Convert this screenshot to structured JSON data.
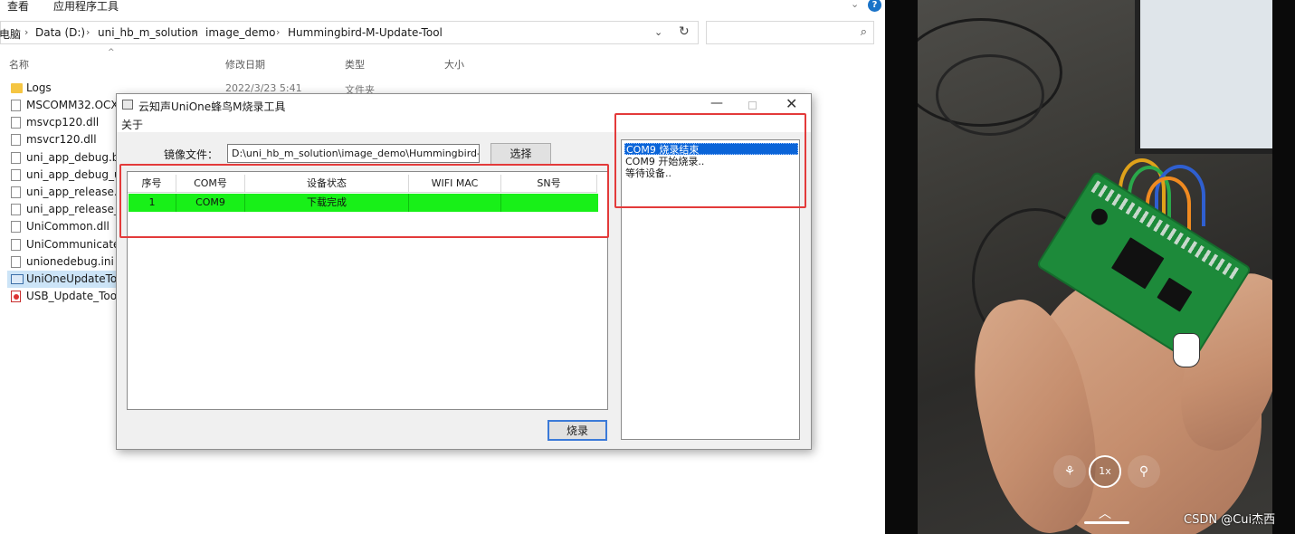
{
  "explorer": {
    "ribbon": {
      "tab_view": "查看",
      "tab_app_tools": "应用程序工具"
    },
    "breadcrumb": {
      "root": "电脑",
      "parts": [
        "Data (D:)",
        "uni_hb_m_solution",
        "image_demo",
        "Hummingbird-M-Update-Tool"
      ]
    },
    "columns": {
      "name": "名称",
      "date": "修改日期",
      "type": "类型",
      "size": "大小"
    },
    "first_row": {
      "date": "2022/3/23 5:41",
      "type": "文件夹"
    },
    "files": [
      {
        "name": "Logs",
        "icon": "folder-icon"
      },
      {
        "name": "MSCOMM32.OCX",
        "icon": "file-icon"
      },
      {
        "name": "msvcp120.dll",
        "icon": "dll-file-icon"
      },
      {
        "name": "msvcr120.dll",
        "icon": "dll-file-icon"
      },
      {
        "name": "uni_app_debug.bin",
        "icon": "file-icon"
      },
      {
        "name": "uni_app_debug_up",
        "icon": "file-icon"
      },
      {
        "name": "uni_app_release.bin",
        "icon": "file-icon"
      },
      {
        "name": "uni_app_release_up",
        "icon": "file-icon"
      },
      {
        "name": "UniCommon.dll",
        "icon": "dll-file-icon"
      },
      {
        "name": "UniCommunicateSv",
        "icon": "dll-file-icon"
      },
      {
        "name": "unionedebug.ini",
        "icon": "ini-file-icon"
      },
      {
        "name": "UniOneUpdateTool",
        "icon": "app-icon"
      },
      {
        "name": "USB_Update_Tool_",
        "icon": "pdf-file-icon"
      }
    ]
  },
  "dialog": {
    "title": "云知声UniOne蜂鸟M烧录工具",
    "menu_about": "关于",
    "image_file_label": "镜像文件：",
    "image_file_path": "D:\\uni_hb_m_solution\\image_demo\\Hummingbird-M-U",
    "select_button": "选择",
    "burn_button": "烧录",
    "table": {
      "headers": [
        "序号",
        "COM号",
        "设备状态",
        "WIFI MAC",
        "SN号"
      ],
      "rows": [
        {
          "index": "1",
          "com": "COM9",
          "status": "下载完成",
          "mac": "",
          "sn": ""
        }
      ]
    },
    "log": [
      "COM9 烧录结束",
      "COM9 开始烧录..",
      "等待设备.."
    ],
    "colors": {
      "row_highlight": "#18f018",
      "log_selected": "#0a64d8",
      "annotation": "#e33a3a"
    }
  },
  "video": {
    "zoom_label": "1x",
    "watermark": "CSDN @Cui杰西"
  }
}
